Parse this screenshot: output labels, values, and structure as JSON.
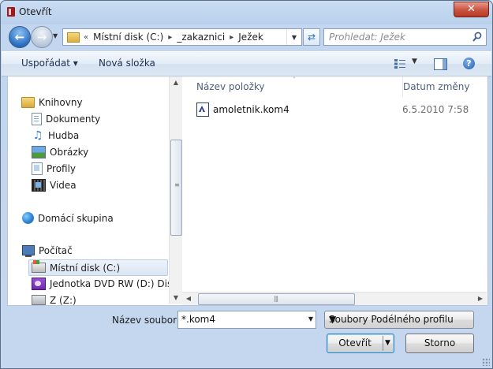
{
  "window": {
    "title": "Otevřít",
    "close_label": "✕"
  },
  "navigation": {
    "back_icon": "back-arrow-icon",
    "forward_icon": "forward-arrow-icon",
    "breadcrumb_overflow": "«",
    "breadcrumbs": [
      "Místní disk (C:)",
      "_zakaznici",
      "Ježek"
    ],
    "search_placeholder": "Prohledat: Ježek"
  },
  "toolbar": {
    "organize_label": "Uspořádat ▾",
    "new_folder_label": "Nová složka",
    "help_label": "?"
  },
  "sidebar": {
    "items": [
      {
        "label": "Knihovny",
        "icon": "libraries-icon"
      },
      {
        "label": "Dokumenty",
        "icon": "documents-icon"
      },
      {
        "label": "Hudba",
        "icon": "music-icon"
      },
      {
        "label": "Obrázky",
        "icon": "pictures-icon"
      },
      {
        "label": "Profily",
        "icon": "profiles-icon"
      },
      {
        "label": "Videa",
        "icon": "videos-icon"
      },
      {
        "label": "Domácí skupina",
        "icon": "homegroup-icon"
      },
      {
        "label": "Počítač",
        "icon": "computer-icon"
      },
      {
        "label": "Místní disk (C:)",
        "icon": "local-disk-icon",
        "selected": true
      },
      {
        "label": "Jednotka DVD RW (D:) Disk",
        "icon": "dvd-drive-icon"
      },
      {
        "label": "Z (Z:)",
        "icon": "network-drive-icon"
      }
    ]
  },
  "file_list": {
    "columns": [
      "Název položky",
      "Datum změny"
    ],
    "rows": [
      {
        "name": "amoletnik.kom4",
        "date": "6.5.2010 7:58",
        "icon": "kom4-file-icon"
      }
    ]
  },
  "footer": {
    "filename_label": "Název souboru:",
    "filename_value": "*.kom4",
    "filter_value": "Soubory Podélného profilu (*.k",
    "open_label": "Otevřít",
    "cancel_label": "Storno"
  },
  "colors": {
    "accent": "#2a6fc2",
    "window_frame": "#c4d7ee",
    "close_button": "#c9523f"
  }
}
